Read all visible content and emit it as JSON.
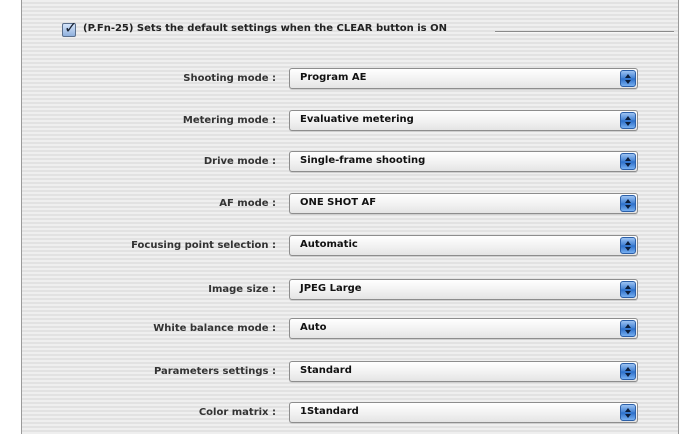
{
  "header": {
    "checked": true,
    "title": "(P.Fn-25) Sets the default settings when the CLEAR button is ON"
  },
  "settings": [
    {
      "label": "Shooting mode :",
      "value": "Program AE"
    },
    {
      "label": "Metering mode :",
      "value": "Evaluative metering"
    },
    {
      "label": "Drive mode :",
      "value": "Single-frame shooting"
    },
    {
      "label": "AF mode :",
      "value": "ONE SHOT AF"
    },
    {
      "label": "Focusing point selection :",
      "value": "Automatic"
    },
    {
      "label": "Image size :",
      "value": "JPEG Large"
    },
    {
      "label": "White balance mode :",
      "value": "Auto"
    },
    {
      "label": "Parameters settings :",
      "value": "Standard"
    },
    {
      "label": "Color matrix :",
      "value": "1Standard"
    }
  ],
  "icons": {
    "checkbox": "checkmark-icon",
    "popup_arrows": "up-down-arrows-icon"
  },
  "colors": {
    "accent": "#3f7fd3",
    "panel_background": "#ececec"
  }
}
